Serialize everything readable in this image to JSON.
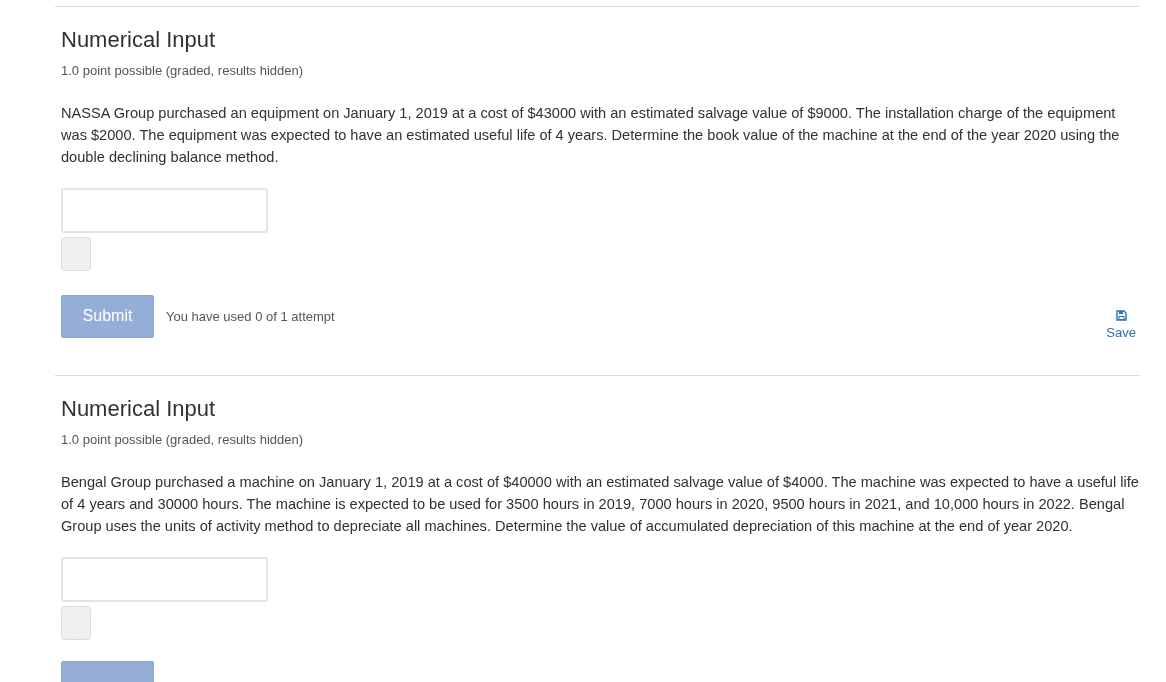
{
  "problems": [
    {
      "title": "Numerical Input",
      "points": "1.0 point possible (graded, results hidden)",
      "question": "NASSA Group purchased an equipment on January 1, 2019 at a cost of $43000 with an estimated salvage value of $9000. The installation charge of the equipment was $2000. The equipment was expected to have an estimated useful life of 4 years. Determine the book value of the machine at the end of the year 2020 using the double declining balance method.",
      "submit": "Submit",
      "attempts": "You have used 0 of 1 attempt",
      "save": "Save"
    },
    {
      "title": "Numerical Input",
      "points": "1.0 point possible (graded, results hidden)",
      "question": "Bengal Group purchased a machine on January 1, 2019 at a cost of $40000 with an estimated salvage value of $4000. The machine was expected to have a useful life of 4 years and 30000 hours. The machine is expected to be used for 3500 hours in 2019, 7000 hours in 2020, 9500 hours in 2021, and 10,000 hours in 2022. Bengal Group uses the units of activity method to depreciate all machines. Determine the value of accumulated depreciation of this machine at the end of year 2020."
    }
  ]
}
